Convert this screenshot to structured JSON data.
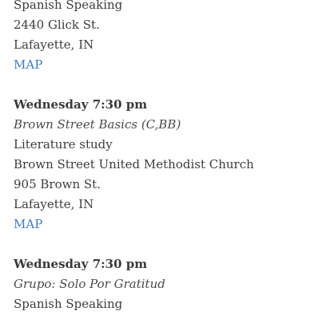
{
  "meetings": [
    {
      "type": "Spanish Speaking",
      "street": "2440 Glick St.",
      "city": "Lafayette, IN",
      "map_label": "MAP"
    },
    {
      "day_time": "Wednesday 7:30 pm",
      "group": "Brown Street Basics (C,BB)",
      "format": "Literature study",
      "venue": "Brown Street United Methodist Church",
      "street": "905 Brown St.",
      "city": "Lafayette, IN",
      "map_label": "MAP"
    },
    {
      "day_time": "Wednesday 7:30 pm",
      "group": "Grupo: Solo Por Gratitud",
      "type": "Spanish Speaking"
    }
  ],
  "colors": {
    "text": "#3d3d3d",
    "link": "#3f7cc2"
  }
}
